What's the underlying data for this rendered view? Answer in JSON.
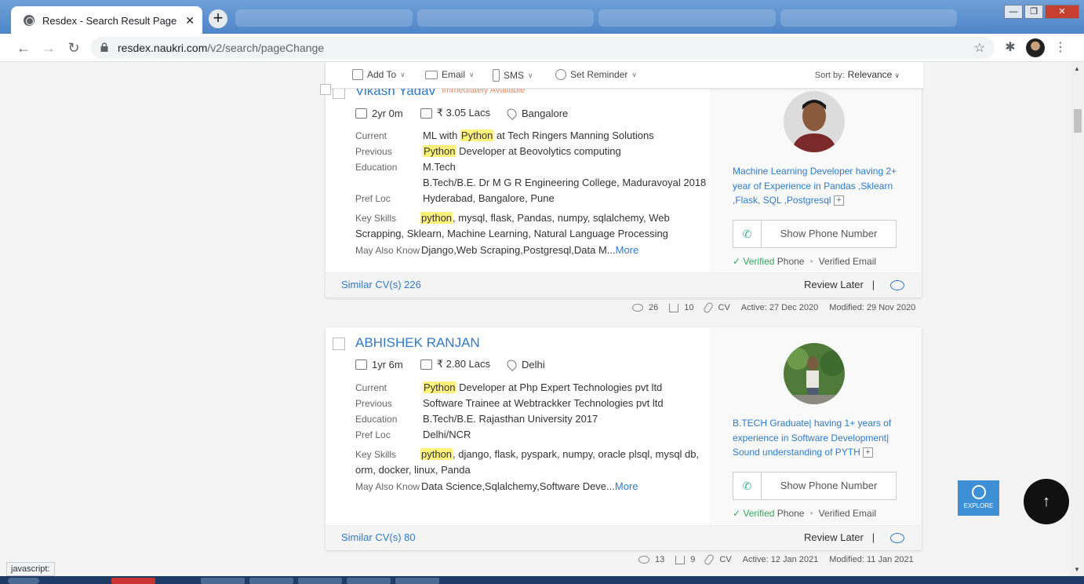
{
  "browser": {
    "tab_title": "Resdex - Search Result Page",
    "tab_close": "✕",
    "new_tab": "+",
    "url_domain": "resdex.naukri.com",
    "url_path": "/v2/search/pageChange",
    "win_min": "—",
    "win_max": "❐",
    "win_close": "✕",
    "status_text": "javascript:"
  },
  "actions": {
    "add_to": "Add To",
    "email": "Email",
    "sms": "SMS",
    "set_reminder": "Set Reminder",
    "sort_label": "Sort by:",
    "sort_value": "Relevance"
  },
  "candidates": [
    {
      "name": "Vikash Yadav",
      "availability": "Immediately Available",
      "experience": "2yr 0m",
      "salary": "₹ 3.05 Lacs",
      "location": "Bangalore",
      "current_label": "Current",
      "current_hl": "Python",
      "current_pre": "ML with ",
      "current_post": " at Tech Ringers Manning Solutions",
      "previous_label": "Previous",
      "previous_hl": "Python",
      "previous_post": " Developer at Beovolytics computing",
      "education_label": "Education",
      "education_1": "M.Tech",
      "education_2": "B.Tech/B.E. Dr M G R Engineering College, Maduravoyal 2018",
      "prefloc_label": "Pref Loc",
      "prefloc": "Hyderabad, Bangalore, Pune",
      "skills_label": "Key Skills",
      "skills_hl": "python",
      "skills_rest": ", mysql, flask, Pandas, numpy, sqlalchemy, Web Scrapping, Sklearn, Machine Learning, Natural Language Processing",
      "also_label": "May Also Know",
      "also": "Django,Web Scraping,Postgresql,Data M...",
      "more": "More",
      "headline": "Machine Learning Developer having 2+ year of Experience in Pandas ,Sklearn ,Flask, SQL ,Postgresql",
      "show_phone": "Show Phone Number",
      "verified_word": "Verified",
      "phone_word": "Phone",
      "verified_email": "Verified Email",
      "similar": "Similar CV(s) 226",
      "review_later": "Review Later",
      "separator": "|",
      "views": "26",
      "downloads": "10",
      "cv": "CV",
      "active": "Active: 27 Dec 2020",
      "modified": "Modified: 29 Nov 2020"
    },
    {
      "name": "ABHISHEK RANJAN",
      "experience": "1yr 6m",
      "salary": "₹ 2.80 Lacs",
      "location": "Delhi",
      "current_label": "Current",
      "current_hl": "Python",
      "current_post": " Developer at Php Expert Technologies pvt ltd",
      "previous_label": "Previous",
      "previous": "Software Trainee at Webtrackker Technologies pvt ltd",
      "education_label": "Education",
      "education_1": "B.Tech/B.E. Rajasthan University 2017",
      "prefloc_label": "Pref Loc",
      "prefloc": "Delhi/NCR",
      "skills_label": "Key Skills",
      "skills_hl": "python",
      "skills_rest": ", django, flask, pyspark, numpy, oracle plsql, mysql db, orm, docker, linux, Panda",
      "also_label": "May Also Know",
      "also": "Data Science,Sqlalchemy,Software Deve...",
      "more": "More",
      "headline": "B.TECH Graduate| having 1+ years of experience in Software Development| Sound understanding of PYTH",
      "show_phone": "Show Phone Number",
      "verified_word": "Verified",
      "phone_word": "Phone",
      "verified_email": "Verified Email",
      "similar": "Similar CV(s) 80",
      "review_later": "Review Later",
      "separator": "|",
      "views": "13",
      "downloads": "9",
      "cv": "CV",
      "active": "Active: 12 Jan 2021",
      "modified": "Modified: 11 Jan 2021"
    }
  ],
  "floating": {
    "explore": "EXPLORE",
    "scroll_top": "↑"
  }
}
